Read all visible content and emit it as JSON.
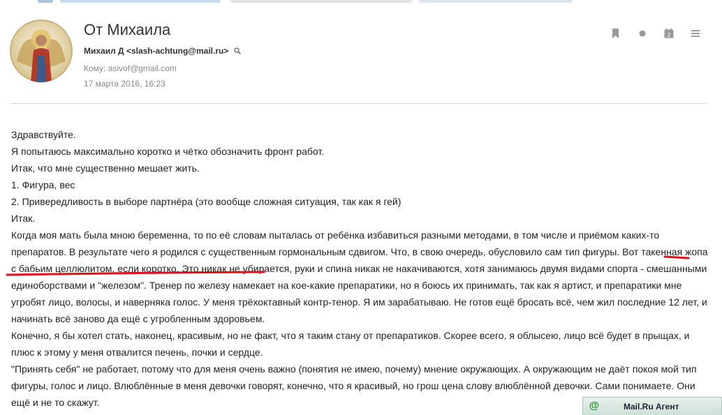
{
  "message": {
    "subject": "От Михаила",
    "sender": "Михаил Д <slash-achtung@mail.ru>",
    "recipient": "Кому: asivof@gmail.com",
    "date": "17 марта 2016, 16:23"
  },
  "toolbar_icons": [
    "bookmark-icon",
    "dot-icon",
    "calendar-icon",
    "menu-icon"
  ],
  "body": {
    "paragraphs": [
      "Здравствуйте.",
      "Я попытаюсь максимально коротко и чётко обозначить фронт работ.",
      "Итак, что мне существенно мешает жить.",
      "1. Фигура, вес",
      "2. Привередливость в выборе партнёра (это вообще сложная ситуация, так как я гей)",
      "Итак.",
      "Когда моя мать была мною беременна, то по её словам пыталась от ребёнка избавиться разными методами, в том числе и приёмом каких-то препаратов. В результате чего я родился с существенным гормональным сдвигом. Что, в свою очередь, обусловило сам тип фигуры. Вот такенная жопа с бабьим целлюлитом, если коротко. Это никак не убирается, руки и спина никак не накачиваются, хотя занимаюсь двумя видами спорта - смешанными единоборствами и \"железом\". Тренер по железу намекает на кое-какие препаратики, но я боюсь их принимать, так как я артист, и препаратики мне угробят лицо, волосы, и наверняка голос. У меня трёхоктавный контр-тенор. Я им зарабатываю. Не готов ещё бросать всё, чем жил последние 12 лет, и начинать всё заново да ещё с угробленным здоровьем.",
      "Конечно, я бы хотел стать, наконец, красивым, но не факт, что я таким стану от препаратиков. Скорее всего, я облысею, лицо всё будет в прыщах, и плюс к этому у меня отвалится печень, почки и сердце.",
      "\"Принять себя\" не работает, потому что для меня очень важно (понятия не имею, почему) мнение окружающих. А окружающим не даёт покоя мой тип фигуры, голос и лицо. Влюблённые в меня девочки говорят, конечно, что я красивый, но грош цена слову влюблённой девочки. Сами понимаете. Они ещё и не то скажут."
    ]
  },
  "agent_bar": {
    "label": "Mail.Ru Агент",
    "icon": "at-icon"
  },
  "colors": {
    "link_blue": "#1a6fb8",
    "underline_red": "#e0101a",
    "meta_gray": "#888888"
  }
}
